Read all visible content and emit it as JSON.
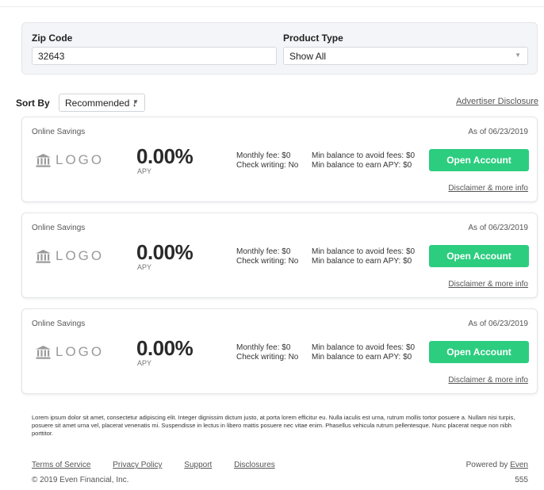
{
  "filters": {
    "zip_label": "Zip Code",
    "zip_value": "32643",
    "product_label": "Product Type",
    "product_value": "Show All"
  },
  "sort": {
    "label": "Sort By",
    "value": "Recommended ↓",
    "caret": "▼"
  },
  "advertiser_disclosure": "Advertiser Disclosure",
  "offers": [
    {
      "type": "Online Savings",
      "date": "As of 06/23/2019",
      "logo_text": "LOGO",
      "logo_icon": "bank-icon",
      "apy": "0.00%",
      "apy_label": "APY",
      "monthly_fee": "Monthly fee: $0",
      "check_writing": "Check writing: No",
      "min_balance_fees": "Min balance to avoid fees: $0",
      "min_balance_apy": "Min balance to earn APY: $0",
      "button": "Open Account",
      "disclaimer": "Disclaimer & more info"
    },
    {
      "type": "Online Savings",
      "date": "As of 06/23/2019",
      "logo_text": "LOGO",
      "logo_icon": "bank-icon",
      "apy": "0.00%",
      "apy_label": "APY",
      "monthly_fee": "Monthly fee: $0",
      "check_writing": "Check writing: No",
      "min_balance_fees": "Min balance to avoid fees: $0",
      "min_balance_apy": "Min balance to earn APY: $0",
      "button": "Open Account",
      "disclaimer": "Disclaimer & more info"
    },
    {
      "type": "Online Savings",
      "date": "As of 06/23/2019",
      "logo_text": "LOGO",
      "logo_icon": "bank-icon",
      "apy": "0.00%",
      "apy_label": "APY",
      "monthly_fee": "Monthly fee: $0",
      "check_writing": "Check writing: No",
      "min_balance_fees": "Min balance to avoid fees: $0",
      "min_balance_apy": "Min balance to earn APY: $0",
      "button": "Open Account",
      "disclaimer": "Disclaimer & more info"
    }
  ],
  "legal_text": "Lorem ipsum dolor sit amet, consectetur adipiscing elit. Integer dignissim dictum justo, at porta lorem efficitur eu. Nulla iaculis est urna, rutrum mollis tortor posuere a. Nullam nisi turpis, posuere sit amet urna vel, placerat venenatis mi. Suspendisse in lectus in libero mattis posuere nec vitae enim. Phasellus vehicula rutrum pellentesque. Nunc placerat neque non nibh porttitor.",
  "footer": {
    "links": [
      "Terms of Service",
      "Privacy Policy",
      "Support",
      "Disclosures"
    ],
    "powered_by_prefix": "Powered by",
    "powered_by_link": "Even",
    "copyright": "© 2019 Even Financial, Inc.",
    "page_number": "555"
  },
  "colors": {
    "accent_button": "#2ccd7f",
    "panel_bg": "#f3f5f8",
    "logo_gray": "#9a9a9a"
  }
}
